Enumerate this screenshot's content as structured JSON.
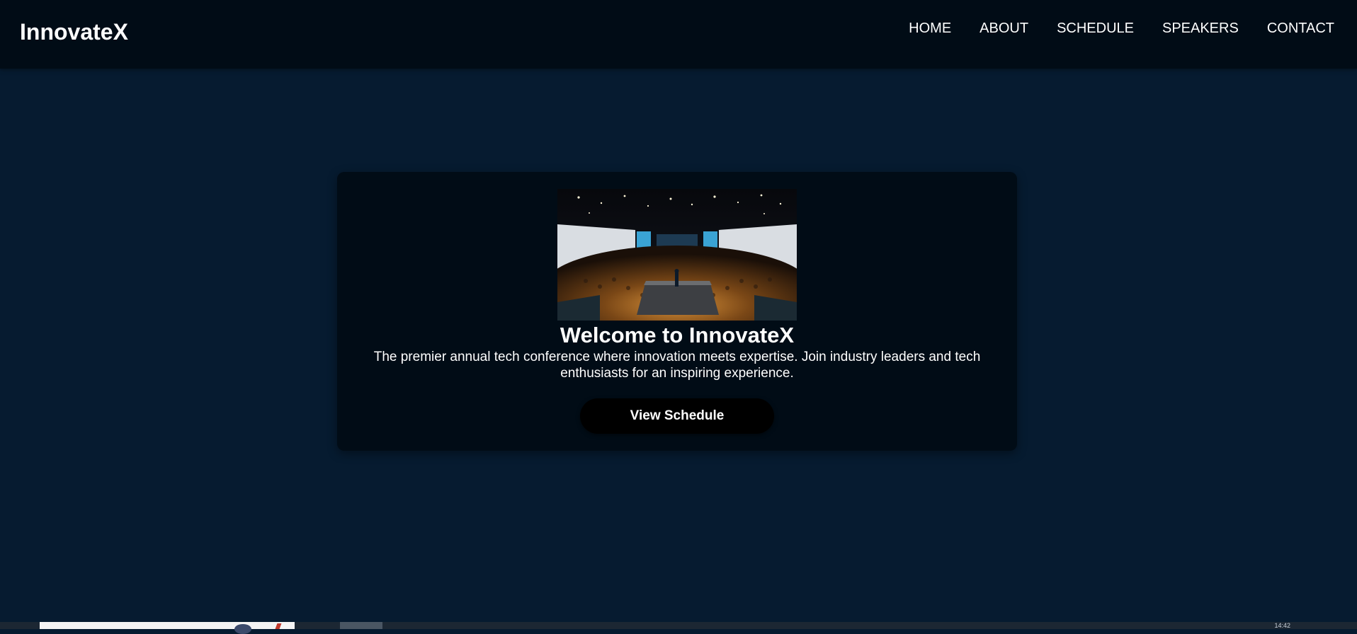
{
  "brand": {
    "name": "InnovateX"
  },
  "nav": {
    "items": [
      {
        "label": "HOME"
      },
      {
        "label": "ABOUT"
      },
      {
        "label": "SCHEDULE"
      },
      {
        "label": "SPEAKERS"
      },
      {
        "label": "CONTACT"
      }
    ]
  },
  "hero": {
    "image_icon": "conference-stage-photo",
    "title": "Welcome to InnovateX",
    "description": "The premier annual tech conference where innovation meets expertise. Join industry leaders and tech enthusiasts for an inspiring experience.",
    "cta_label": "View Schedule"
  },
  "taskbar": {
    "clock": "14:42"
  },
  "colors": {
    "page_bg": "#061b30",
    "nav_bg": "#010c16",
    "card_bg": "#010c16",
    "button_bg": "#000000",
    "text": "#ffffff"
  }
}
